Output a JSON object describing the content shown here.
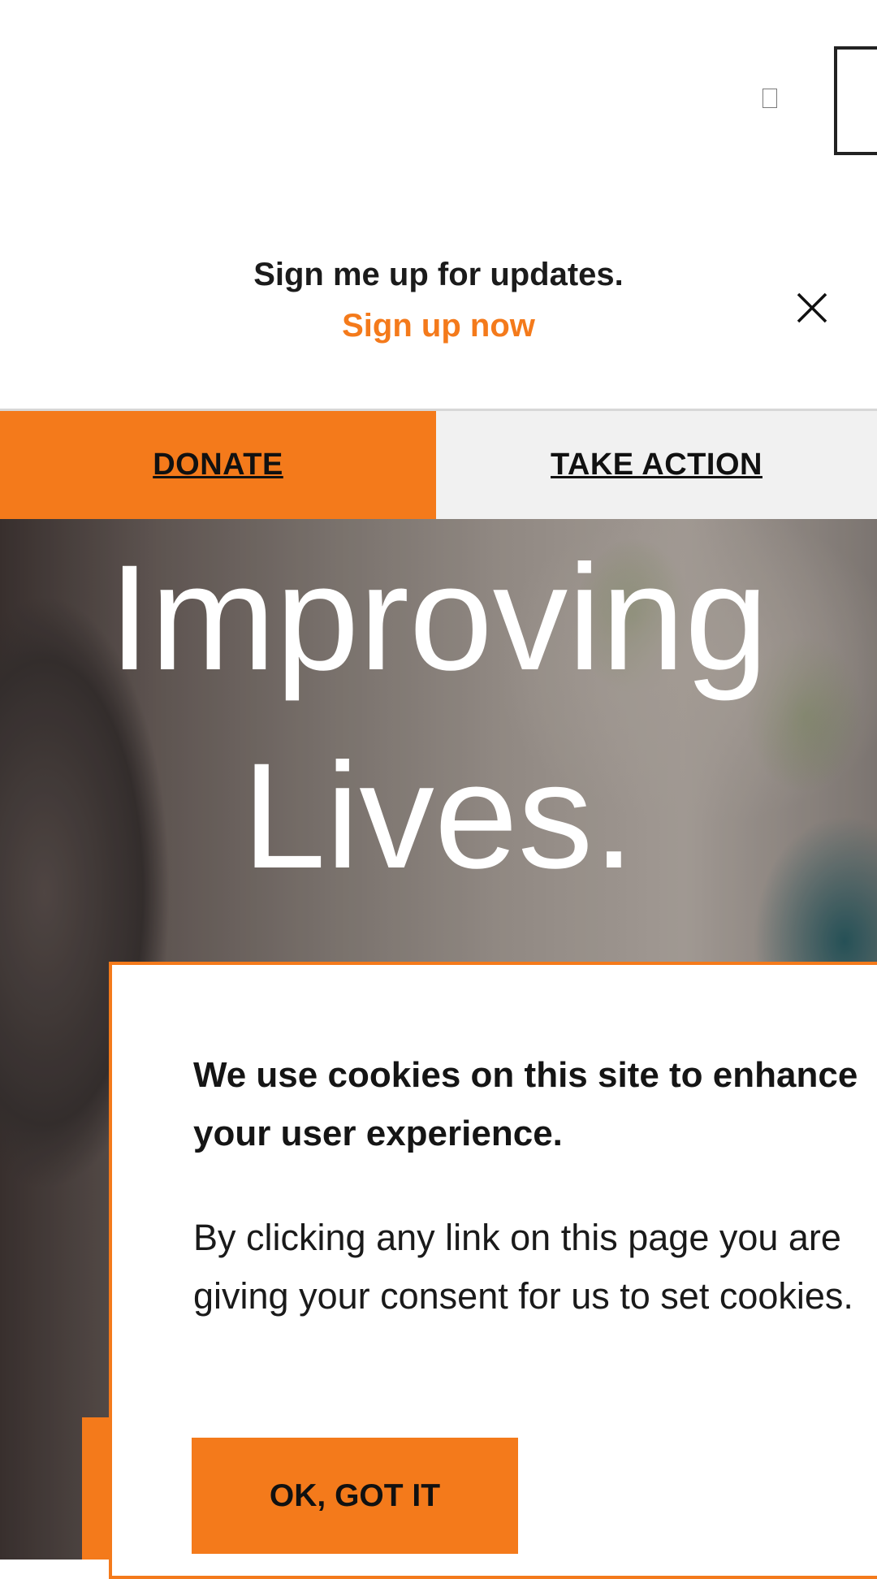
{
  "signup_banner": {
    "message": "Sign me up for updates.",
    "link": "Sign up now"
  },
  "cta": {
    "donate": "DONATE",
    "take_action": "TAKE ACTION"
  },
  "hero": {
    "line1": "Improving",
    "line2": "Lives."
  },
  "cookie_notice": {
    "title": "We use cookies on this site to enhance your user experience.",
    "body": "By clicking any link on this page you are giving your consent for us to set cookies.",
    "button": "OK, GOT IT"
  },
  "colors": {
    "accent": "#f47a1b",
    "tab_inactive": "#f1f1f1",
    "text_dark": "#1b1b1b"
  },
  "icons": [
    "close-icon",
    "menu-icon",
    "missing-glyph-icon"
  ]
}
